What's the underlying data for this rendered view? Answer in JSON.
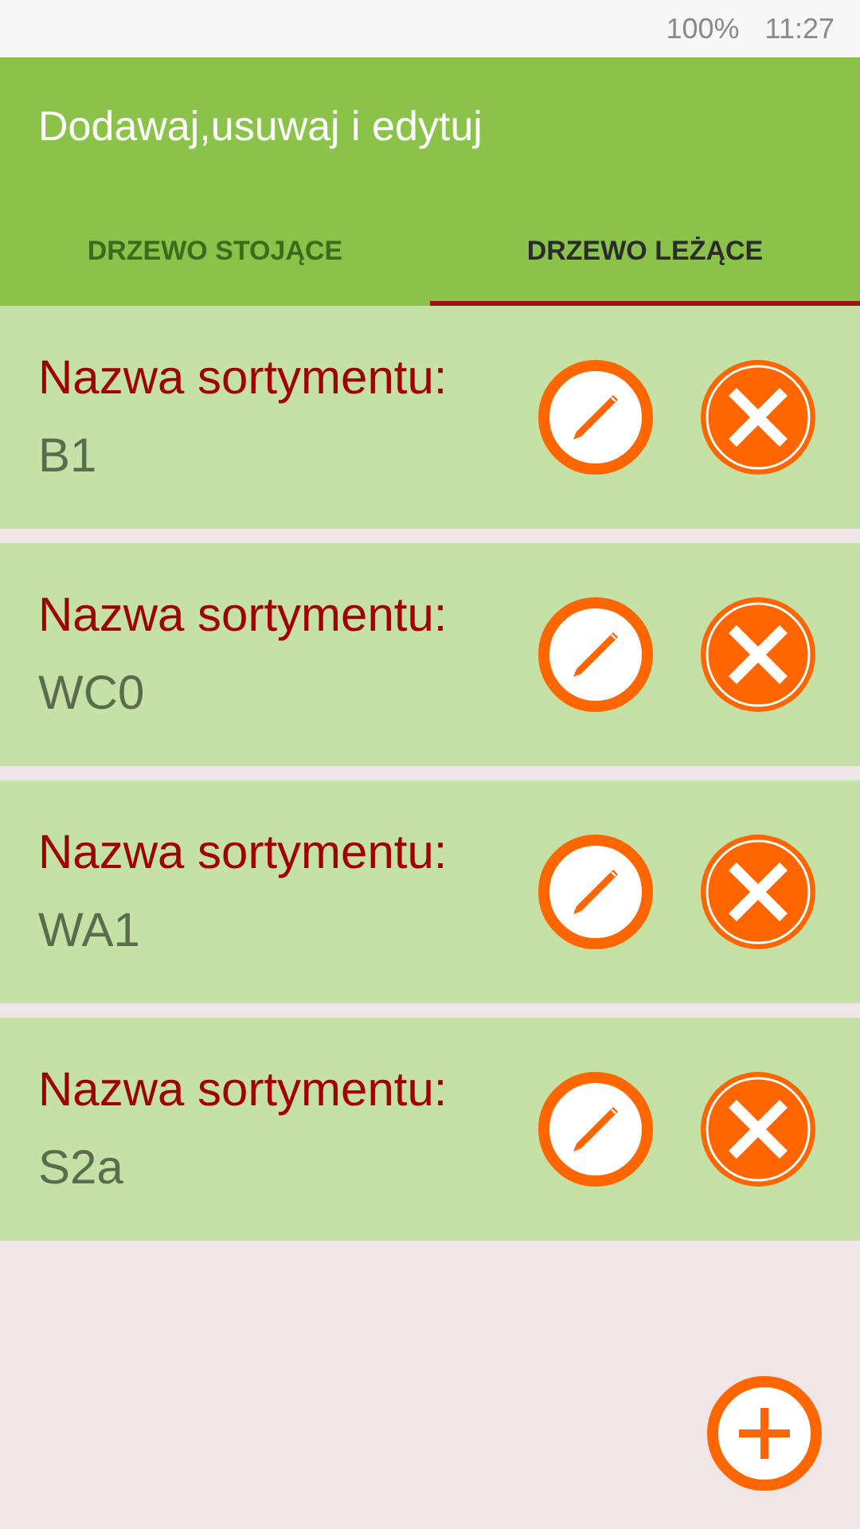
{
  "status_bar": {
    "battery": "100%",
    "time": "11:27"
  },
  "app_bar": {
    "title": "Dodawaj,usuwaj i edytuj"
  },
  "tabs": [
    {
      "label": "DRZEWO STOJĄCE",
      "selected": false
    },
    {
      "label": "DRZEWO LEŻĄCE",
      "selected": true
    }
  ],
  "items": [
    {
      "label": "Nazwa sortymentu:",
      "value": "B1"
    },
    {
      "label": "Nazwa sortymentu:",
      "value": "WC0"
    },
    {
      "label": "Nazwa sortymentu:",
      "value": "WA1"
    },
    {
      "label": "Nazwa sortymentu:",
      "value": "S2a"
    }
  ]
}
